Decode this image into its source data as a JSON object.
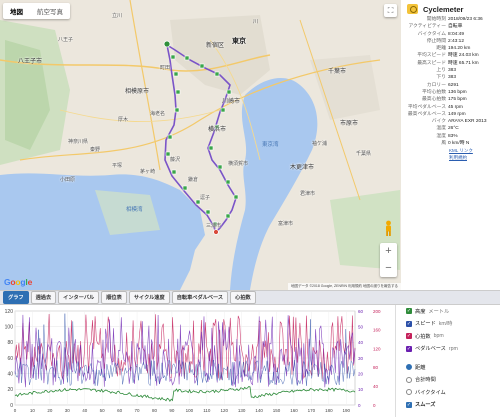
{
  "map": {
    "tabs": [
      {
        "label": "地図",
        "active": true
      },
      {
        "label": "航空写真",
        "active": false
      }
    ],
    "google_label": "Google",
    "attribution": "地図データ ©2018 Google, ZENRIN   利用規約   地図の誤りを報告する",
    "zoom_in": "+",
    "zoom_out": "−",
    "labels": {
      "hachioji": "八王子市",
      "tachikawa": "立川",
      "kawasaki_n": "川",
      "shinjuku": "新宿区",
      "tokyo": "東京",
      "chiba": "千葉市",
      "sagamihara": "相模原市",
      "kawasaki": "川崎市",
      "yokohama": "横浜市",
      "ichihara": "市原市",
      "kisarazu": "木更津市",
      "chiba_pref": "千葉県",
      "kanagawa": "神奈川県",
      "hiratsuka": "平塚",
      "odawara": "小田原",
      "sagami_bay": "相模湾",
      "miura": "三浦市",
      "tokyo_bay": "東京湾",
      "sodegaura": "袖ケ浦",
      "atsugi": "厚木",
      "kimitsu": "君津市",
      "futtsu": "富津市",
      "ebina": "海老名",
      "fujisawa": "藤沢",
      "chigasaki": "茅ヶ崎",
      "hachioji_area": "八王子",
      "machida": "町田",
      "kamakura": "鎌倉",
      "yokosuka": "横須賀市",
      "zushi": "逗子",
      "hadano": "秦野"
    }
  },
  "info": {
    "title": "Cyclemeter",
    "stats": [
      {
        "k": "開始時刻",
        "v": "2018/09/23 6:36"
      },
      {
        "k": "アクティビティー",
        "v": "自転車"
      },
      {
        "k": "バイクタイム",
        "v": "8:04:49"
      },
      {
        "k": "停止時間",
        "v": "2:43:12"
      },
      {
        "k": "距離",
        "v": "194.20 km"
      },
      {
        "k": "平均スピード",
        "v": "時速 24.03 km"
      },
      {
        "k": "最高スピード",
        "v": "時速 65.71 km"
      },
      {
        "k": "上り",
        "v": "383"
      },
      {
        "k": "下り",
        "v": "383"
      },
      {
        "k": "カロリー",
        "v": "6291"
      },
      {
        "k": "平均心拍数",
        "v": "136 bpm"
      },
      {
        "k": "最高心拍数",
        "v": "175 bpm"
      },
      {
        "k": "平均ペダルベース",
        "v": "45 rpm"
      },
      {
        "k": "最高ペダルベース",
        "v": "149 rpm"
      },
      {
        "k": "バイク",
        "v": "ARAYA EXR 2013"
      },
      {
        "k": "温度",
        "v": "26°C"
      },
      {
        "k": "湿度",
        "v": "83%"
      },
      {
        "k": "風",
        "v": "0 km/時 N"
      }
    ],
    "links": [
      "KML リンク",
      "利用規約"
    ]
  },
  "tabs": [
    "グラフ",
    "週過去",
    "インターバル",
    "順位表",
    "サイクル速度",
    "自転車ペダルベース",
    "心拍数"
  ],
  "graph": {
    "left_ticks": [
      "120",
      "100",
      "80",
      "60",
      "40",
      "20",
      "0"
    ],
    "right1_ticks": [
      "60",
      "50",
      "40",
      "30",
      "20",
      "10",
      "0"
    ],
    "right2_ticks": [
      "200",
      "160",
      "120",
      "80",
      "40",
      "0"
    ],
    "x_ticks": [
      "0",
      "10",
      "20",
      "30",
      "40",
      "50",
      "60",
      "70",
      "80",
      "90",
      "100",
      "110",
      "120",
      "130",
      "140",
      "150",
      "160",
      "170",
      "180",
      "190"
    ]
  },
  "legend": {
    "series": [
      {
        "label": "高度",
        "unit": "メートル",
        "color": "#2e8b3a"
      },
      {
        "label": "スピード",
        "unit": "km/時",
        "color": "#2b4fa8"
      },
      {
        "label": "心拍数",
        "unit": "bpm",
        "color": "#c4205a"
      },
      {
        "label": "ペダルベース",
        "unit": "rpm",
        "color": "#6a1fb0"
      }
    ],
    "options": [
      {
        "label": "距離",
        "on": true
      },
      {
        "label": "合計時間",
        "on": false
      },
      {
        "label": "バイクタイム",
        "on": false
      }
    ],
    "smooth": "スムーズ"
  }
}
